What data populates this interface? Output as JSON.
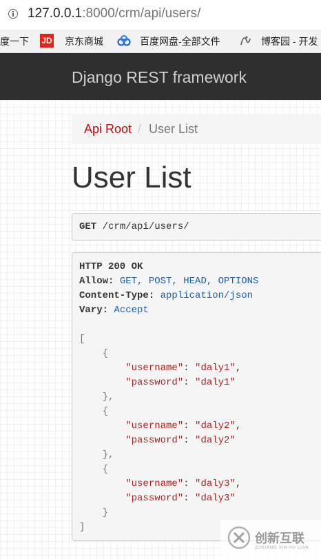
{
  "browser": {
    "url_host": "127.0.0.1",
    "url_rest": ":8000/crm/api/users/",
    "bookmarks": [
      {
        "label": "度一下",
        "icon": "none"
      },
      {
        "label": "京东商城",
        "icon": "jd-icon"
      },
      {
        "label": "百度网盘-全部文件",
        "icon": "baidu-cloud-icon"
      },
      {
        "label": "博客园 - 开发",
        "icon": "cnblogs-icon"
      }
    ],
    "jd_icon_text": "JD"
  },
  "navbar": {
    "brand": "Django REST framework"
  },
  "breadcrumb": {
    "root": "Api Root",
    "separator": "/",
    "current": "User List"
  },
  "page_title": "User List",
  "request": {
    "method": "GET",
    "path": " /crm/api/users/"
  },
  "response": {
    "status_line": "HTTP 200 OK",
    "headers": [
      {
        "name": "Allow:",
        "value": " GET, POST, HEAD, OPTIONS"
      },
      {
        "name": "Content-Type:",
        "value": " application/json"
      },
      {
        "name": "Vary:",
        "value": " Accept"
      }
    ],
    "body": [
      {
        "username": "daly1",
        "password": "daly1"
      },
      {
        "username": "daly2",
        "password": "daly2"
      },
      {
        "username": "daly3",
        "password": "daly3"
      }
    ],
    "key_username": "\"username\"",
    "key_password": "\"password\""
  },
  "watermark": {
    "text": "创新互联",
    "sub": "CHUANG XIN HU LIAN"
  },
  "colors": {
    "navbar_bg": "#2f2f2f",
    "link": "#c20c0c",
    "json_string": "#b41e1e",
    "header_value": "#1f5ea8"
  }
}
